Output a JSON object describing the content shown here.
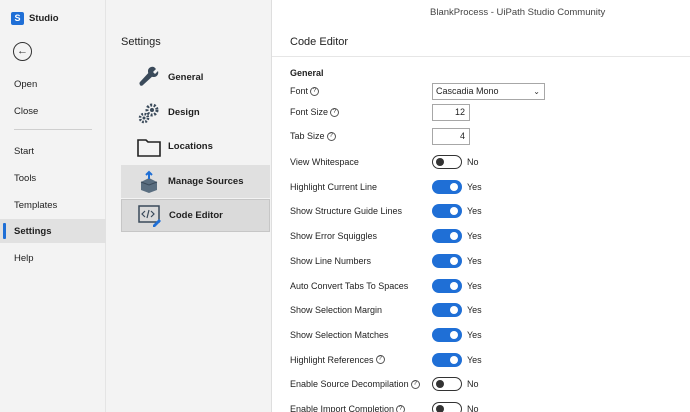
{
  "app": {
    "brand": "Studio",
    "window_title": "BlankProcess - UiPath Studio Community"
  },
  "rail": {
    "back_icon": "back-arrow-icon",
    "items": [
      {
        "label": "Open"
      },
      {
        "label": "Close"
      },
      {
        "label": "Start"
      },
      {
        "label": "Tools"
      },
      {
        "label": "Templates"
      },
      {
        "label": "Settings",
        "active": true
      },
      {
        "label": "Help"
      }
    ]
  },
  "settings": {
    "title": "Settings",
    "categories": [
      {
        "label": "General",
        "icon": "wrench-icon"
      },
      {
        "label": "Design",
        "icon": "gears-icon"
      },
      {
        "label": "Locations",
        "icon": "folder-icon"
      },
      {
        "label": "Manage Sources",
        "icon": "box-upload-icon"
      },
      {
        "label": "Code Editor",
        "icon": "code-editor-icon",
        "selected": true
      }
    ]
  },
  "main": {
    "title": "Code Editor",
    "section": "General",
    "font": {
      "label": "Font",
      "value": "Cascadia Mono"
    },
    "font_size": {
      "label": "Font Size",
      "value": "12"
    },
    "tab_size": {
      "label": "Tab Size",
      "value": "4"
    },
    "toggles": [
      {
        "label": "View Whitespace",
        "state": "No",
        "on": false,
        "help": false
      },
      {
        "label": "Highlight Current Line",
        "state": "Yes",
        "on": true,
        "help": false
      },
      {
        "label": "Show Structure Guide Lines",
        "state": "Yes",
        "on": true,
        "help": false
      },
      {
        "label": "Show Error Squiggles",
        "state": "Yes",
        "on": true,
        "help": false
      },
      {
        "label": "Show Line Numbers",
        "state": "Yes",
        "on": true,
        "help": false
      },
      {
        "label": "Auto Convert Tabs To Spaces",
        "state": "Yes",
        "on": true,
        "help": false
      },
      {
        "label": "Show Selection Margin",
        "state": "Yes",
        "on": true,
        "help": false
      },
      {
        "label": "Show Selection Matches",
        "state": "Yes",
        "on": true,
        "help": false
      },
      {
        "label": "Highlight References",
        "state": "Yes",
        "on": true,
        "help": true
      },
      {
        "label": "Enable Source Decompilation",
        "state": "No",
        "on": false,
        "help": true
      },
      {
        "label": "Enable Import Completion",
        "state": "No",
        "on": false,
        "help": true
      }
    ]
  },
  "colors": {
    "accent": "#1f6fd6",
    "rail_bg": "#f3f3f3"
  }
}
